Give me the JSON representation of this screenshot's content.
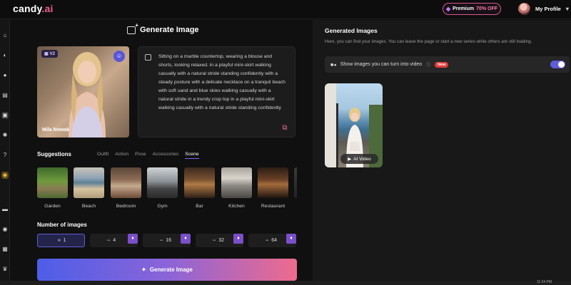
{
  "app": {
    "logo_main": "candy",
    "logo_accent": ".ai"
  },
  "topbar": {
    "premium_label": "Premium",
    "premium_off": "70% OFF",
    "profile_label": "My Profile"
  },
  "generate": {
    "title": "Generate Image",
    "character": {
      "badge": "V2",
      "name": "Mila Nowak"
    },
    "prompt": "Sitting on a marble countertop, wearing a blouse and shorts, looking relaxed. in a playful mini-skirt walking casually with a natural stride standing confidently with a steady posture with a delicate necklace on a tranquil beach with soft sand and blue skies walking casually with a natural stride in a trendy crop top in a playful mini-skirt walking casually with a natural stride standing confidently",
    "suggestions_label": "Suggestions",
    "tabs": [
      "Outfit",
      "Action",
      "Pose",
      "Accessories",
      "Scene"
    ],
    "active_tab": "Scene",
    "scenes": [
      "Garden",
      "Beach",
      "Bedroom",
      "Gym",
      "Bar",
      "Kitchen",
      "Restaurant"
    ],
    "num_images_label": "Number of images",
    "num_options": [
      "1",
      "4",
      "16",
      "32",
      "64"
    ],
    "button_label": "Generate Image"
  },
  "results": {
    "title": "Generated Images",
    "subtitle": "Here, you can find your images. You can leave the page or start a new series while others are still loading.",
    "video_toggle_label": "Show images you can turn into video",
    "new_badge": "New",
    "ai_video_label": "AI Video"
  },
  "taskbar": {
    "time": "11:24 PM"
  },
  "colors": {
    "accent": "#5e5cd8",
    "pink": "#ee6b8d",
    "premium_border": "#d65a8a"
  }
}
